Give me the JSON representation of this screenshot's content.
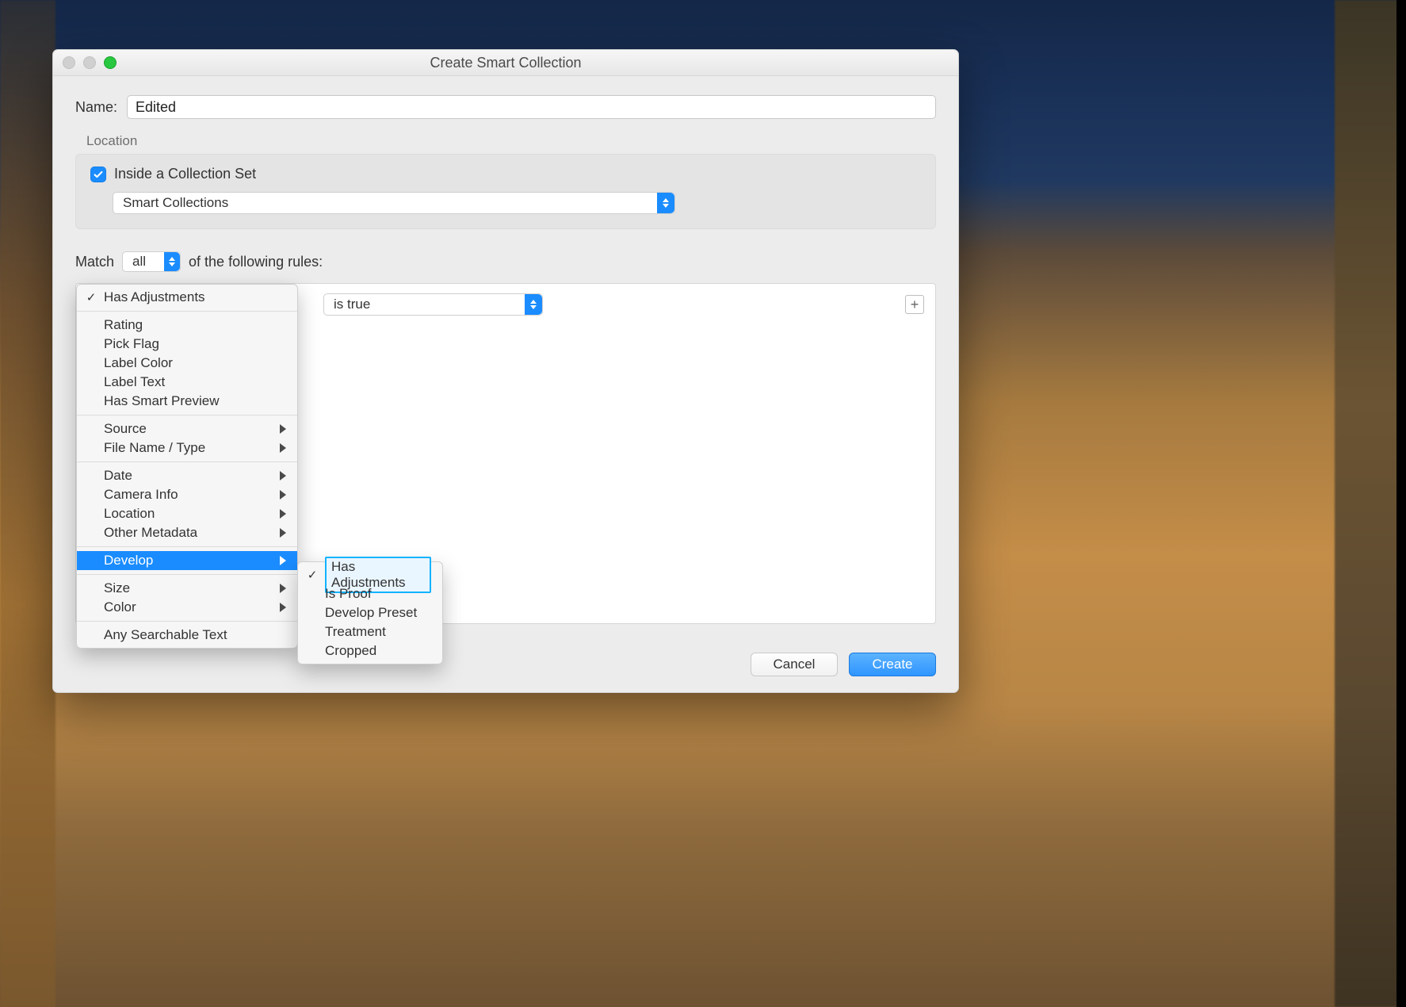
{
  "window": {
    "title": "Create Smart Collection"
  },
  "name": {
    "label": "Name:",
    "value": "Edited"
  },
  "location": {
    "heading": "Location",
    "inside_label": "Inside a Collection Set",
    "inside_checked": true,
    "set_value": "Smart Collections"
  },
  "match": {
    "prefix": "Match",
    "mode": "all",
    "suffix": "of the following rules:"
  },
  "rule": {
    "condition_value": "is true",
    "add_label": "+"
  },
  "menu": {
    "groups": [
      {
        "items": [
          {
            "label": "Has Adjustments",
            "checked": true
          }
        ]
      },
      {
        "items": [
          {
            "label": "Rating"
          },
          {
            "label": "Pick Flag"
          },
          {
            "label": "Label Color"
          },
          {
            "label": "Label Text"
          },
          {
            "label": "Has Smart Preview"
          }
        ]
      },
      {
        "items": [
          {
            "label": "Source",
            "submenu": true
          },
          {
            "label": "File Name / Type",
            "submenu": true
          }
        ]
      },
      {
        "items": [
          {
            "label": "Date",
            "submenu": true
          },
          {
            "label": "Camera Info",
            "submenu": true
          },
          {
            "label": "Location",
            "submenu": true
          },
          {
            "label": "Other Metadata",
            "submenu": true
          }
        ]
      },
      {
        "items": [
          {
            "label": "Develop",
            "submenu": true,
            "highlight": true
          }
        ]
      },
      {
        "items": [
          {
            "label": "Size",
            "submenu": true
          },
          {
            "label": "Color",
            "submenu": true
          }
        ]
      },
      {
        "items": [
          {
            "label": "Any Searchable Text"
          }
        ]
      }
    ]
  },
  "submenu": {
    "items": [
      {
        "label": "Has Adjustments",
        "checked": true,
        "selected": true
      },
      {
        "label": "Is Proof"
      },
      {
        "label": "Develop Preset"
      },
      {
        "label": "Treatment"
      },
      {
        "label": "Cropped"
      }
    ]
  },
  "footer": {
    "cancel": "Cancel",
    "create": "Create"
  }
}
